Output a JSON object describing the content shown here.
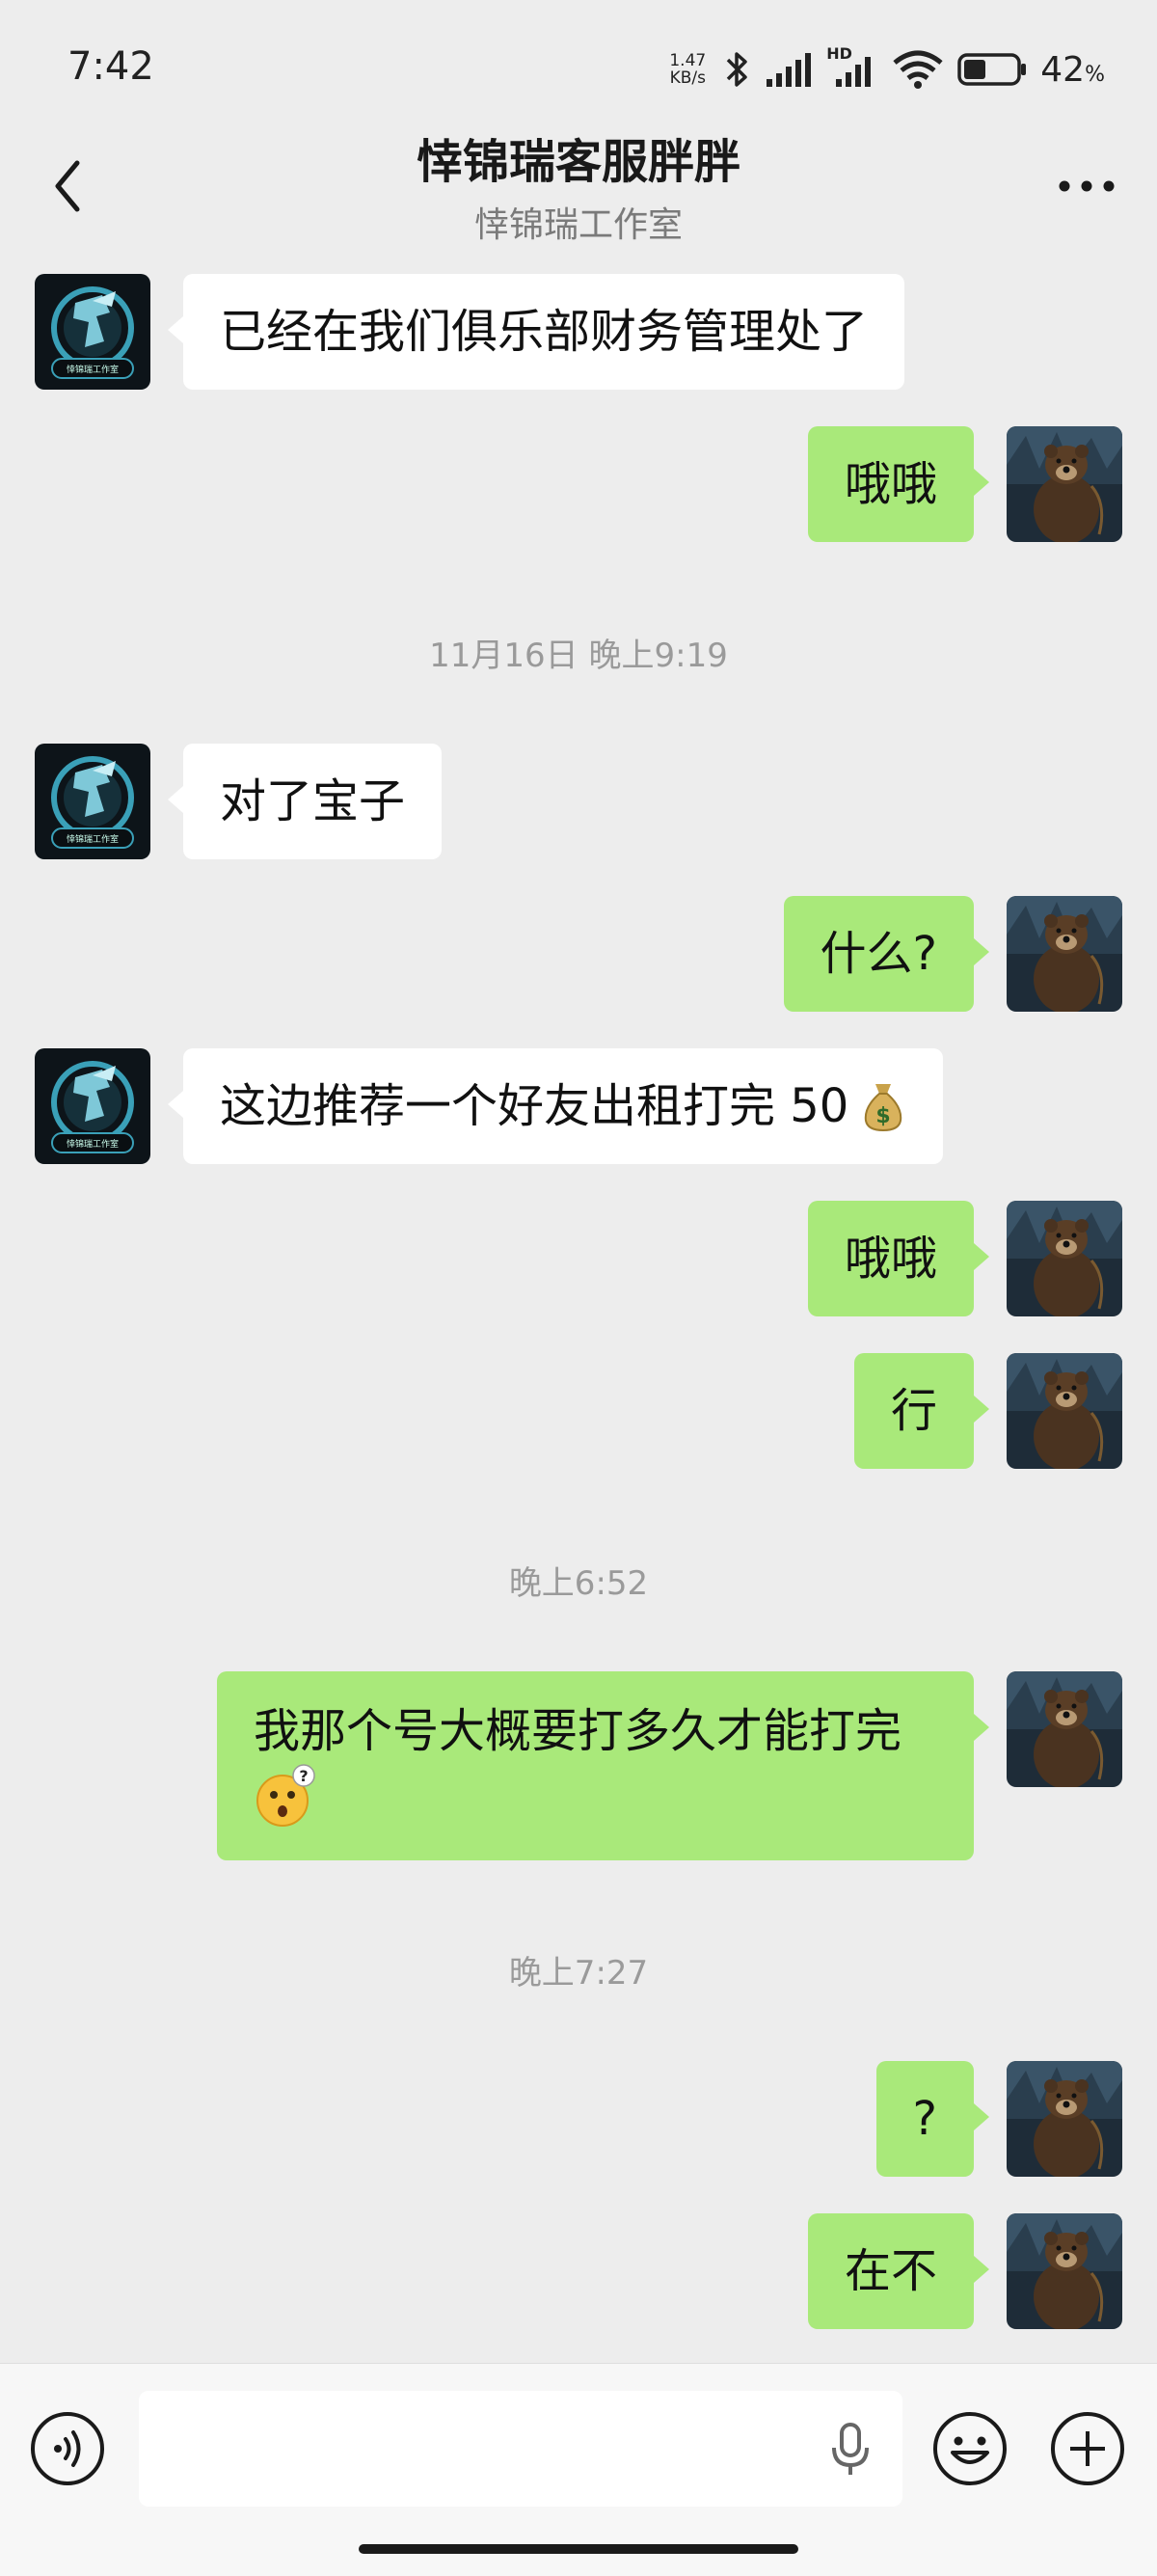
{
  "status_bar": {
    "time": "7:42",
    "net_speed_value": "1.47",
    "net_speed_unit": "KB/s",
    "hd_label": "HD",
    "battery_pct": "42",
    "battery_pct_unit": "%",
    "battery_level": 0.42
  },
  "header": {
    "title": "悻锦瑞客服胖胖",
    "subtitle": "悻锦瑞工作室"
  },
  "messages": {
    "m1": {
      "sender": "other",
      "text": "已经在我们俱乐部财务管理处了"
    },
    "m2": {
      "sender": "me",
      "text": "哦哦"
    },
    "t1": "11月16日 晚上9:19",
    "m3": {
      "sender": "other",
      "text": "对了宝子"
    },
    "m4": {
      "sender": "me",
      "text": "什么?"
    },
    "m5": {
      "sender": "other",
      "text": "这边推荐一个好友出租打完 50"
    },
    "m6": {
      "sender": "me",
      "text": "哦哦"
    },
    "m7": {
      "sender": "me",
      "text": "行"
    },
    "t2": "晚上6:52",
    "m8": {
      "sender": "me",
      "text": "我那个号大概要打多久才能打完"
    },
    "t3": "晚上7:27",
    "m9": {
      "sender": "me",
      "text": "?"
    },
    "m10": {
      "sender": "me",
      "text": "在不"
    }
  },
  "avatars": {
    "other_logo_text": "悻锦瑞工作室"
  },
  "input_bar": {
    "placeholder": ""
  },
  "icons": {
    "back": "chevron-left-icon",
    "more": "more-dots-icon",
    "voice": "voice-icon",
    "mic": "microphone-icon",
    "emoji": "emoji-icon",
    "plus": "plus-icon",
    "money": "money-bag-emoji",
    "thinking": "confused-face-emoji"
  },
  "colors": {
    "background": "#ededed",
    "bubble_out": "#a9e97a",
    "bubble_in": "#ffffff"
  }
}
